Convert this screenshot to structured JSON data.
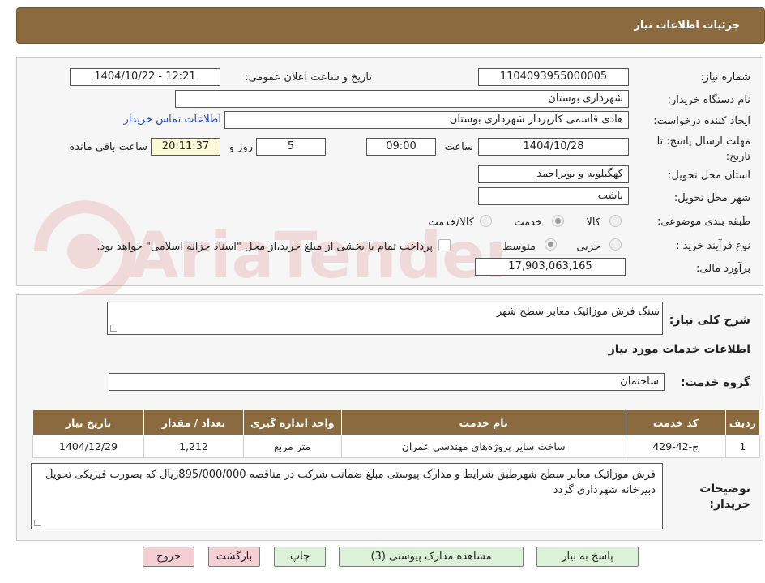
{
  "header": {
    "title": "جزئیات اطلاعات نیاز"
  },
  "info": {
    "need_number_label": "شماره نیاز:",
    "need_number": "1104093955000005",
    "announce_label": "تاریخ و ساعت اعلان عمومی:",
    "announce_value": "1404/10/22 - 12:21",
    "buyer_org_label": "نام دستگاه خریدار:",
    "buyer_org": "شهرداری بوستان",
    "requester_label": "ایجاد کننده درخواست:",
    "requester": "هادی قاسمی کارپرداز شهرداری بوستان",
    "contact_link": "اطلاعات تماس خریدار",
    "deadline_label_line1": "مهلت ارسال پاسخ: تا",
    "deadline_label_line2": "تاریخ:",
    "deadline_date": "1404/10/28",
    "time_label": "ساعت",
    "deadline_time": "09:00",
    "days_value": "5",
    "days_label": "روز و",
    "remaining_time": "20:11:37",
    "remaining_label": "ساعت باقی مانده",
    "province_label": "استان محل تحویل:",
    "province": "کهگیلویه و بویراحمد",
    "city_label": "شهر محل تحویل:",
    "city": "باشت",
    "category_label": "طبقه بندی موضوعی:",
    "category_options": [
      "کالا",
      "خدمت",
      "کالا/خدمت"
    ],
    "category_selected": "خدمت",
    "process_label": "نوع فرآیند خرید :",
    "process_options": [
      "جزیی",
      "متوسط"
    ],
    "process_selected": "متوسط",
    "payment_note": "پرداخت تمام یا بخشی از مبلغ خرید،از محل \"اسناد خزانه اسلامی\" خواهد بود.",
    "budget_label": "برآورد مالی:",
    "budget": "17,903,063,165"
  },
  "description": {
    "general_label": "شرح کلی نیاز:",
    "general_value": "سنگ فرش موزائیک معابر سطح شهر",
    "services_heading": "اطلاعات خدمات مورد نیاز",
    "group_label": "گروه خدمت:",
    "group_value": "ساختمان"
  },
  "table": {
    "headers": [
      "ردیف",
      "کد خدمت",
      "نام خدمت",
      "واحد اندازه گیری",
      "تعداد / مقدار",
      "تاریخ نیاز"
    ],
    "rows": [
      [
        "1",
        "ج-42-429",
        "ساخت سایر پروژه‌های مهندسی عمران",
        "متر مربع",
        "1,212",
        "1404/12/29"
      ]
    ]
  },
  "buyer_notes": {
    "label_line1": "توضیحات",
    "label_line2": "خریدار:",
    "text": "فرش موزائیک معابر سطح شهرطبق شرایط و مدارک پیوستی  مبلغ ضمانت شرکت در مناقصه 895/000/000ریال که بصورت فیزیکی تحویل دبیرخانه شهرداری گردد"
  },
  "buttons": {
    "reply": "پاسخ به نیاز",
    "attachments": "مشاهده مدارک پیوستی (3)",
    "print": "چاپ",
    "back": "بازگشت",
    "exit": "خروج"
  },
  "watermark": {
    "text": "AriaTender.net"
  },
  "colors": {
    "header_bg": "#8c6a3f",
    "button_green": "#dbf2d8",
    "button_pink": "#f5cfd4",
    "link": "#2048c0"
  }
}
